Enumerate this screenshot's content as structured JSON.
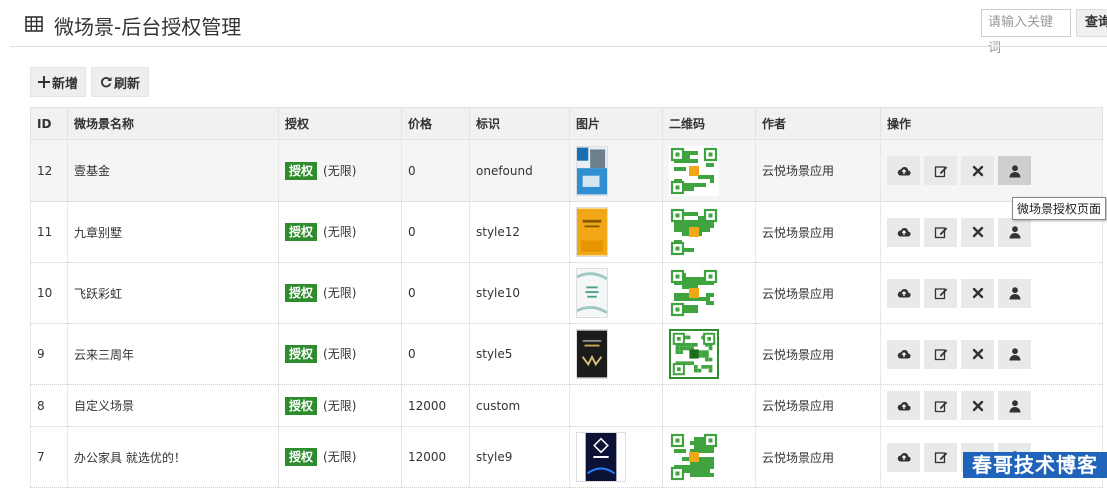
{
  "header": {
    "title": "微场景-后台授权管理",
    "search_placeholder": "请输入关键词",
    "search_button": "查询"
  },
  "toolbar": {
    "add_label": "新增",
    "refresh_label": "刷新"
  },
  "table": {
    "columns": [
      "ID",
      "微场景名称",
      "授权",
      "价格",
      "标识",
      "图片",
      "二维码",
      "作者",
      "操作"
    ],
    "auth_label": "授权",
    "auth_note": "(无限)",
    "rows": [
      {
        "id": "12",
        "name": "壹基金",
        "price": "0",
        "tag": "onefound",
        "author": "云悦场景应用",
        "has_image": true,
        "has_qr": true
      },
      {
        "id": "11",
        "name": "九章别墅",
        "price": "0",
        "tag": "style12",
        "author": "云悦场景应用",
        "has_image": true,
        "has_qr": true
      },
      {
        "id": "10",
        "name": "飞跃彩虹",
        "price": "0",
        "tag": "style10",
        "author": "云悦场景应用",
        "has_image": true,
        "has_qr": true
      },
      {
        "id": "9",
        "name": "云来三周年",
        "price": "0",
        "tag": "style5",
        "author": "云悦场景应用",
        "has_image": true,
        "has_qr": true
      },
      {
        "id": "8",
        "name": "自定义场景",
        "price": "12000",
        "tag": "custom",
        "author": "云悦场景应用",
        "has_image": false,
        "has_qr": false
      },
      {
        "id": "7",
        "name": "办公家具 就选优的！",
        "price": "12000",
        "tag": "style9",
        "author": "云悦场景应用",
        "has_image": true,
        "has_qr": true
      }
    ],
    "action_icons": [
      "cloud-upload-icon",
      "edit-icon",
      "delete-icon",
      "user-icon"
    ]
  },
  "tooltip": "微场景授权页面",
  "watermark": "春哥技术博客",
  "colors": {
    "auth_tag": "#2e8b2e",
    "watermark_bg": "#1f63ba",
    "qr_green": "#3fa33f"
  }
}
